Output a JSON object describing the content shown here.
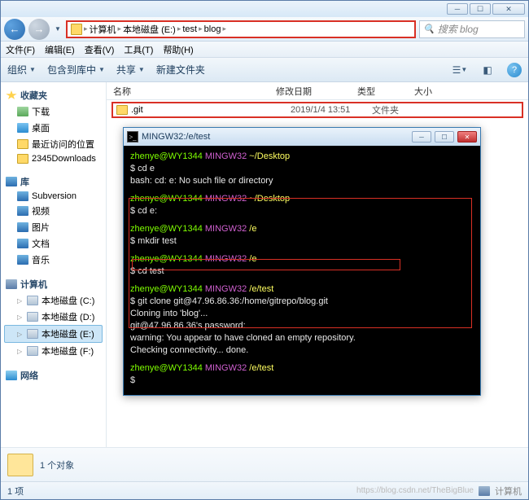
{
  "titlebar": {
    "min": "─",
    "max": "☐",
    "close": "✕"
  },
  "nav": {
    "breadcrumb": [
      "计算机",
      "本地磁盘 (E:)",
      "test",
      "blog"
    ],
    "search_placeholder": "搜索 blog"
  },
  "menu": [
    "文件(F)",
    "编辑(E)",
    "查看(V)",
    "工具(T)",
    "帮助(H)"
  ],
  "toolbar": {
    "organize": "组织",
    "include": "包含到库中",
    "share": "共享",
    "newfolder": "新建文件夹"
  },
  "sidebar": {
    "favorites": {
      "label": "收藏夹",
      "items": [
        "下载",
        "桌面",
        "最近访问的位置",
        "2345Downloads"
      ]
    },
    "libraries": {
      "label": "库",
      "items": [
        "Subversion",
        "视频",
        "图片",
        "文档",
        "音乐"
      ]
    },
    "computer": {
      "label": "计算机",
      "items": [
        "本地磁盘 (C:)",
        "本地磁盘 (D:)",
        "本地磁盘 (E:)",
        "本地磁盘 (F:)"
      ]
    },
    "network": {
      "label": "网络"
    }
  },
  "columns": {
    "name": "名称",
    "date": "修改日期",
    "type": "类型",
    "size": "大小"
  },
  "files": [
    {
      "name": ".git",
      "date": "2019/1/4 13:51",
      "type": "文件夹"
    }
  ],
  "terminal": {
    "title": "MINGW32:/e/test",
    "lines": [
      {
        "prompt_user": "zhenye@WY1344 ",
        "prompt_sys": "MINGW32 ",
        "prompt_path": "~/Desktop"
      },
      {
        "cmd": "$ cd e"
      },
      {
        "out": "bash: cd: e: No such file or directory"
      },
      {
        "blank": true
      },
      {
        "prompt_user": "zhenye@WY1344 ",
        "prompt_sys": "MINGW32 ",
        "prompt_path": "~/Desktop"
      },
      {
        "cmd": "$ cd e:"
      },
      {
        "blank": true
      },
      {
        "prompt_user": "zhenye@WY1344 ",
        "prompt_sys": "MINGW32 ",
        "prompt_path": "/e"
      },
      {
        "cmd": "$ mkdir test"
      },
      {
        "blank": true
      },
      {
        "prompt_user": "zhenye@WY1344 ",
        "prompt_sys": "MINGW32 ",
        "prompt_path": "/e"
      },
      {
        "cmd": "$ cd test"
      },
      {
        "blank": true
      },
      {
        "prompt_user": "zhenye@WY1344 ",
        "prompt_sys": "MINGW32 ",
        "prompt_path": "/e/test"
      },
      {
        "cmd_hl": "$ git clone git@47.96.86.36:/home/gitrepo/blog.git"
      },
      {
        "out": "Cloning into 'blog'..."
      },
      {
        "out": "git@47.96.86.36's password:"
      },
      {
        "out": "warning: You appear to have cloned an empty repository."
      },
      {
        "out": "Checking connectivity... done."
      },
      {
        "blank": true
      },
      {
        "prompt_user": "zhenye@WY1344 ",
        "prompt_sys": "MINGW32 ",
        "prompt_path": "/e/test"
      },
      {
        "cmd": "$"
      }
    ]
  },
  "details": {
    "count": "1 个对象"
  },
  "status": {
    "items": "1 项",
    "right_label": "计算机",
    "watermark": "https://blog.csdn.net/TheBigBlue"
  }
}
